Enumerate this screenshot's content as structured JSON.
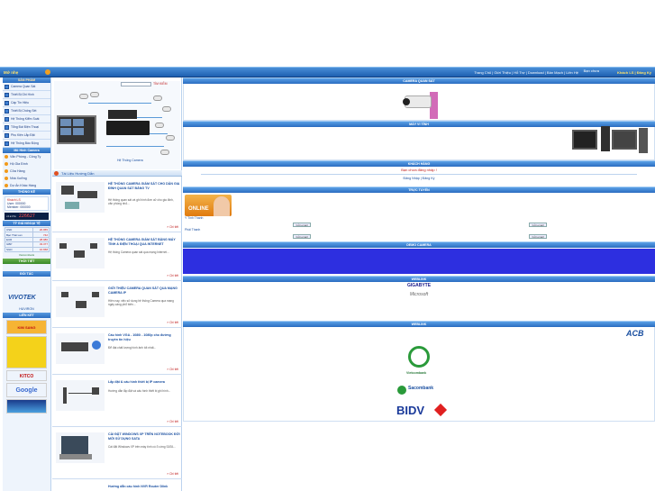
{
  "nav": {
    "home": "Mở nhẹ",
    "links": "Trang Chủ | Giới Thiệu | Hỗ Trợ | Download | Bản Mạch | Liên Hệ",
    "online": "Bạn chưa",
    "visitor": "Khách LS | Đăng Ký"
  },
  "left": {
    "products_head": "SẢN PHẨM",
    "categories": [
      "Camera Quan Sát",
      "Thiết Bị Ghi Hình",
      "Cáp Tín Hiệu",
      "Thiết Bị Chống Sét",
      "Hệ Thống Kiểm Soát",
      "Tổng Đài Điện Thoại",
      "Phụ Kiện Lắp Đặt",
      "Hệ Thống Báo Động"
    ],
    "solutions_head": "Mô Hình Camera",
    "solutions": [
      "Văn Phòng - Công Ty",
      "Hộ Gia Đình",
      "Cửa Hàng",
      "Nhà Xưởng",
      "Dự Án Khác Hàng"
    ],
    "support_head": "THỐNG KÊ",
    "support_name": "Khách LS",
    "stats": [
      {
        "label": "User",
        "value": "000000"
      },
      {
        "label": "Member",
        "value": "000000"
      }
    ],
    "counter_label": "visits",
    "counter": "226627",
    "rate_head": "TỶ GIÁ NGOẠI TỆ",
    "rates": [
      {
        "code": "USD",
        "value": "20.955"
      },
      {
        "code": "Bạc Thái Lan",
        "value": "742"
      },
      {
        "code": "EUR",
        "value": "28.986"
      },
      {
        "code": "GBP",
        "value": "33.377"
      },
      {
        "code": "SGD",
        "value": "16.658"
      }
    ],
    "rate_note": "Vietcombank",
    "weather_head": "THỜI TIẾT",
    "partners_head": "ĐỐI TÁC",
    "links_head": "LIÊN KẾT",
    "vivotek": "VIVOTEK",
    "huviron": "HUVIRON",
    "kim_sang": "KIM SANG",
    "kitco": "KITCO",
    "google": "Google"
  },
  "mid": {
    "search_go": "TÌM KIẾM",
    "hero_caption": "Hệ Thống Camera",
    "docs_head": "Tài Liệu Hướng Dẫn",
    "news": [
      {
        "title": "HỆ THỐNG CAMERA GIÁM SÁT CHO DÂN GIA ĐÌNH QUAN SÁT BẰNG TV",
        "desc": "Hệ thống quan sát và ghi hình đơn cử cho gia đình, văn phòng nhỏ...",
        "more": "» Chi tiết"
      },
      {
        "title": "HỆ THỐNG CAMERA GIÁM SÁT BẰNG MÁY TÍNH & ĐIỆN THOẠI QUA INTERNET",
        "desc": "Hệ thống Camera quan sát qua mạng Internet...",
        "more": "» Chi tiết"
      },
      {
        "title": "GIỚI THIỆU CAMERA QUAN SÁT QUA MẠNG CAMERA IP",
        "desc": "Hiện nay, việc sử dụng hệ thống Camera qua mạng ngày càng phổ biến...",
        "more": "» Chi tiết"
      },
      {
        "title": "Cấu hình VGA - 1080i - 1080p cho đường truyền tín hiệu",
        "desc": "Để đạt chất lượng hình ảnh tốt nhất...",
        "more": "» Chi tiết"
      },
      {
        "title": "Lắp đặt & cấu hình thiết bị IP camera",
        "desc": "Hướng dẫn lắp đặt và cấu hình thiết bị ghi hình...",
        "more": "» Chi tiết"
      },
      {
        "title": "CÀI ĐẶT WINDOWS XP TRÊN NOTEBOOK ĐỜI MỚI SỬ DỤNG SATA",
        "desc": "Cài đặt Windows XP trên máy tính có ổ cứng SATA...",
        "more": "» Chi tiết"
      },
      {
        "title": "Hướng dẫn cấu hình NVR Router Dlink",
        "desc": "",
        "more": ""
      }
    ]
  },
  "right": {
    "bars": [
      "CAMERA QUAN SÁT",
      "MÁY VI TÍNH",
      "KHÁCH HÀNG",
      "TRỰC TUYẾN",
      "DEMO CAMERA",
      "WEBLINK",
      "WEBLINK"
    ],
    "login_msg": "Bạn chưa đăng nhập !",
    "login_links": "Đăng Nhập | Đăng Ký",
    "online_text": "ONLINE",
    "support1": "Y Tình Thanh",
    "support2": "Phải Thanh",
    "btn": "Gửi email",
    "gigabyte": "GIGABYTE",
    "microsoft": "Microsoft",
    "acb": "ACB",
    "vcb": "Vietcombank",
    "sacombank": "Sacombank",
    "bidv": "BIDV"
  }
}
